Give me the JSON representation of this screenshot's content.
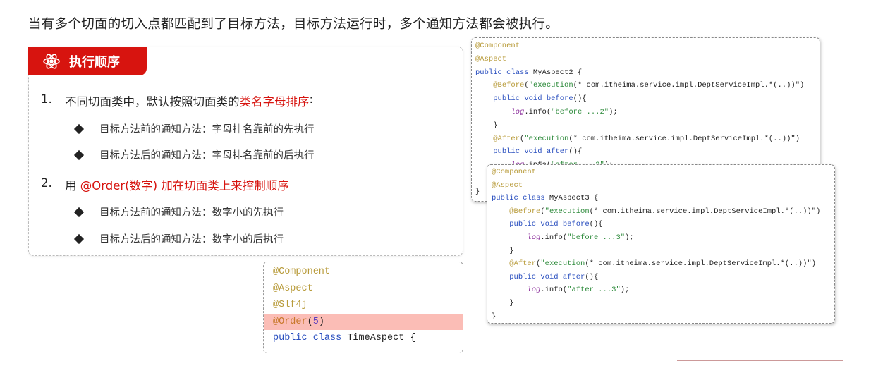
{
  "title": "当有多个切面的切入点都匹配到了目标方法，目标方法运行时，多个通知方法都会被执行。",
  "panel": {
    "tab_label": "执行顺序",
    "tab_icon": "atom-icon",
    "accent_color": "#d7140f",
    "items": [
      {
        "num": "1.",
        "text": "不同切面类中，默认按照切面类的",
        "highlight": "类名字母排序",
        "tail": ":",
        "subs": [
          "目标方法前的通知方法：字母排名靠前的先执行",
          "目标方法后的通知方法：字母排名靠前的后执行"
        ]
      },
      {
        "num": "2.",
        "text": "用 ",
        "highlight": "@Order(数字) 加在切面类上来控制顺序",
        "tail": "",
        "subs": [
          "目标方法前的通知方法：数字小的先执行",
          "目标方法后的通知方法：数字小的后执行"
        ]
      }
    ]
  },
  "code_blocks": [
    {
      "lines": [
        [
          [
            "ann",
            "@Component"
          ]
        ],
        [
          [
            "ann",
            "@Aspect"
          ]
        ],
        [
          [
            "kw",
            "public class "
          ],
          [
            "plain",
            "MyAspect2 {"
          ]
        ],
        [
          [
            "plain",
            "    "
          ],
          [
            "ann",
            "@Before"
          ],
          [
            "plain",
            "("
          ],
          [
            "str",
            "\"execution"
          ],
          [
            "plain",
            "(* com.itheima.service.impl.DeptServiceImpl.*(..))\")"
          ]
        ],
        [
          [
            "plain",
            "    "
          ],
          [
            "kw",
            "public void before"
          ],
          [
            "plain",
            "(){"
          ]
        ],
        [
          [
            "plain",
            "        "
          ],
          [
            "log",
            "log"
          ],
          [
            "plain",
            ".info("
          ],
          [
            "str",
            "\"before ...2\""
          ],
          [
            "plain",
            ");"
          ]
        ],
        [
          [
            "plain",
            "    }"
          ]
        ],
        [
          [
            "plain",
            "    "
          ],
          [
            "ann",
            "@After"
          ],
          [
            "plain",
            "("
          ],
          [
            "str",
            "\"execution"
          ],
          [
            "plain",
            "(* com.itheima.service.impl.DeptServiceImpl.*(..))\")"
          ]
        ],
        [
          [
            "plain",
            "    "
          ],
          [
            "kw",
            "public void after"
          ],
          [
            "plain",
            "(){"
          ]
        ],
        [
          [
            "plain",
            "        "
          ],
          [
            "log",
            "log"
          ],
          [
            "plain",
            ".info("
          ],
          [
            "str",
            "\"after ...2\""
          ],
          [
            "plain",
            ");"
          ]
        ],
        [
          [
            "plain",
            "    }"
          ]
        ],
        [
          [
            "plain",
            "}"
          ]
        ]
      ]
    },
    {
      "lines": [
        [
          [
            "ann",
            "@Component"
          ]
        ],
        [
          [
            "ann",
            "@Aspect"
          ]
        ],
        [
          [
            "kw",
            "public class "
          ],
          [
            "plain",
            "MyAspect3 {"
          ]
        ],
        [
          [
            "plain",
            "    "
          ],
          [
            "ann",
            "@Before"
          ],
          [
            "plain",
            "("
          ],
          [
            "str",
            "\"execution"
          ],
          [
            "plain",
            "(* com.itheima.service.impl.DeptServiceImpl.*(..))\")"
          ]
        ],
        [
          [
            "plain",
            "    "
          ],
          [
            "kw",
            "public void before"
          ],
          [
            "plain",
            "(){"
          ]
        ],
        [
          [
            "plain",
            "        "
          ],
          [
            "log",
            "log"
          ],
          [
            "plain",
            ".info("
          ],
          [
            "str",
            "\"before ...3\""
          ],
          [
            "plain",
            ");"
          ]
        ],
        [
          [
            "plain",
            "    }"
          ]
        ],
        [
          [
            "plain",
            "    "
          ],
          [
            "ann",
            "@After"
          ],
          [
            "plain",
            "("
          ],
          [
            "str",
            "\"execution"
          ],
          [
            "plain",
            "(* com.itheima.service.impl.DeptServiceImpl.*(..))\")"
          ]
        ],
        [
          [
            "plain",
            "    "
          ],
          [
            "kw",
            "public void after"
          ],
          [
            "plain",
            "(){"
          ]
        ],
        [
          [
            "plain",
            "        "
          ],
          [
            "log",
            "log"
          ],
          [
            "plain",
            ".info("
          ],
          [
            "str",
            "\"after ...3\""
          ],
          [
            "plain",
            ");"
          ]
        ],
        [
          [
            "plain",
            "    }"
          ]
        ],
        [
          [
            "plain",
            "}"
          ]
        ]
      ]
    },
    {
      "highlight_line": 3,
      "highlight_color": "#fbbdb6",
      "lines": [
        [
          [
            "ann",
            "@Component"
          ]
        ],
        [
          [
            "ann",
            "@Aspect"
          ]
        ],
        [
          [
            "ann",
            "@Slf4j"
          ]
        ],
        [
          [
            "ord",
            "@Order"
          ],
          [
            "plain",
            "("
          ],
          [
            "num",
            "5"
          ],
          [
            "plain",
            ")"
          ]
        ],
        [
          [
            "kw",
            "public class "
          ],
          [
            "plain",
            "TimeAspect {"
          ]
        ]
      ]
    }
  ]
}
